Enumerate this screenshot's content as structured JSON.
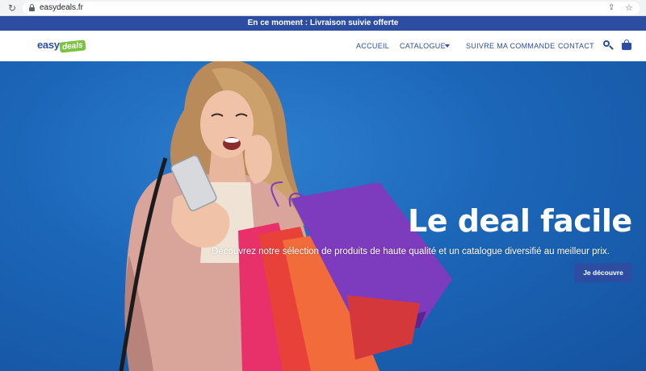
{
  "browser": {
    "url": "easydeals.fr",
    "icons": [
      "reload-icon",
      "lock-icon",
      "share-icon",
      "star-icon"
    ]
  },
  "announcement": {
    "text": "En ce moment : Livraison suivie offerte"
  },
  "header": {
    "logo": {
      "easy": "easy",
      "deals": "deals"
    },
    "nav": [
      {
        "label": "ACCUEIL"
      },
      {
        "label": "CATALOGUE",
        "has_dropdown": true
      },
      {
        "label": "SUIVRE MA COMMANDE"
      },
      {
        "label": "CONTACT"
      }
    ],
    "icons": [
      "search-icon",
      "bag-icon"
    ]
  },
  "hero": {
    "title": "Le deal facile !",
    "subtitle": "Découvrez notre sélection de produits de haute qualité et un catalogue diversifié au meilleur prix.",
    "cta_label": "Je découvre"
  },
  "colors": {
    "brand_blue": "#2c4da1",
    "logo_green": "#7cc243",
    "hero_bg": "#1c66b8",
    "browser_bg": "#f1f3f4"
  }
}
